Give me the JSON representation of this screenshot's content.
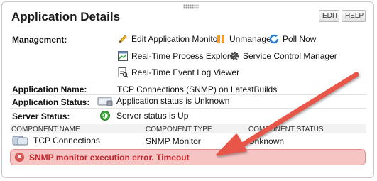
{
  "header": {
    "title": "Application Details",
    "edit_label": "EDIT",
    "help_label": "HELP"
  },
  "management": {
    "label": "Management:",
    "actions": [
      {
        "label": "Edit Application Monitor",
        "icon": "pencil-icon"
      },
      {
        "label": "Unmanage",
        "icon": "pause-icon"
      },
      {
        "label": "Poll Now",
        "icon": "refresh-icon"
      },
      {
        "label": "Real-Time Process Explorer",
        "icon": "process-explorer-icon"
      },
      {
        "label": "Service Control Manager",
        "icon": "gear-icon"
      },
      {
        "label": "Real-Time Event Log Viewer",
        "icon": "event-log-icon"
      }
    ]
  },
  "details": {
    "app_name_label": "Application Name:",
    "app_name_value": "TCP Connections (SNMP) on LatestBuilds",
    "app_status_label": "Application Status:",
    "app_status_value": "Application status is Unknown",
    "server_status_label": "Server Status:",
    "server_status_value": "Server status is Up"
  },
  "table": {
    "headers": [
      "COMPONENT NAME",
      "COMPONENT TYPE",
      "COMPONENT STATUS"
    ],
    "rows": [
      {
        "name": "TCP Connections",
        "type": "SNMP Monitor",
        "status": "Unknown"
      }
    ]
  },
  "error": {
    "message": "SNMP monitor execution error. Timeout"
  },
  "colors": {
    "error_bg": "#f7c4c4",
    "error_text": "#c1272d",
    "arrow": "#e8544a"
  }
}
